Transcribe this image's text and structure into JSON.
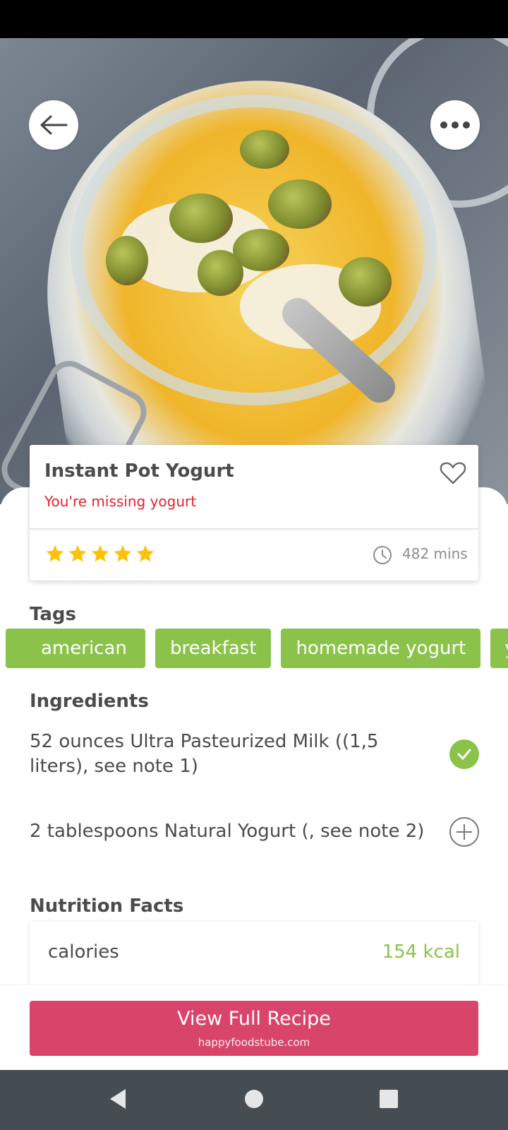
{
  "recipe": {
    "title": "Instant Pot Yogurt",
    "missing_text": "You're missing yogurt",
    "rating": 5,
    "rating_max": 5,
    "time": "482 mins"
  },
  "tags": {
    "title": "Tags",
    "items": [
      "american",
      "breakfast",
      "homemade yogurt",
      "yo"
    ]
  },
  "ingredients": {
    "title": "Ingredients",
    "items": [
      {
        "text": "52 ounces Ultra Pasteurized Milk ((1,5 liters), see note 1)",
        "state": "checked"
      },
      {
        "text": "2 tablespoons Natural Yogurt (, see note 2)",
        "state": "add"
      }
    ]
  },
  "nutrition": {
    "title": "Nutrition Facts",
    "rows": [
      {
        "label": "calories",
        "value": "154 kcal"
      }
    ]
  },
  "cta": {
    "label": "View Full Recipe",
    "source": "happyfoodstube.com"
  },
  "icons": {
    "back": "arrow-left-icon",
    "more": "more-horizontal-icon",
    "favorite": "heart-outline-icon",
    "time": "clock-icon",
    "star": "star-icon",
    "check": "check-circle-icon",
    "add": "plus-circle-icon"
  },
  "colors": {
    "accent_green": "#8bc34a",
    "cta_pink": "#d9456a",
    "missing_red": "#e8202a",
    "star_yellow": "#ffc107",
    "nav_bar": "#454c52"
  }
}
